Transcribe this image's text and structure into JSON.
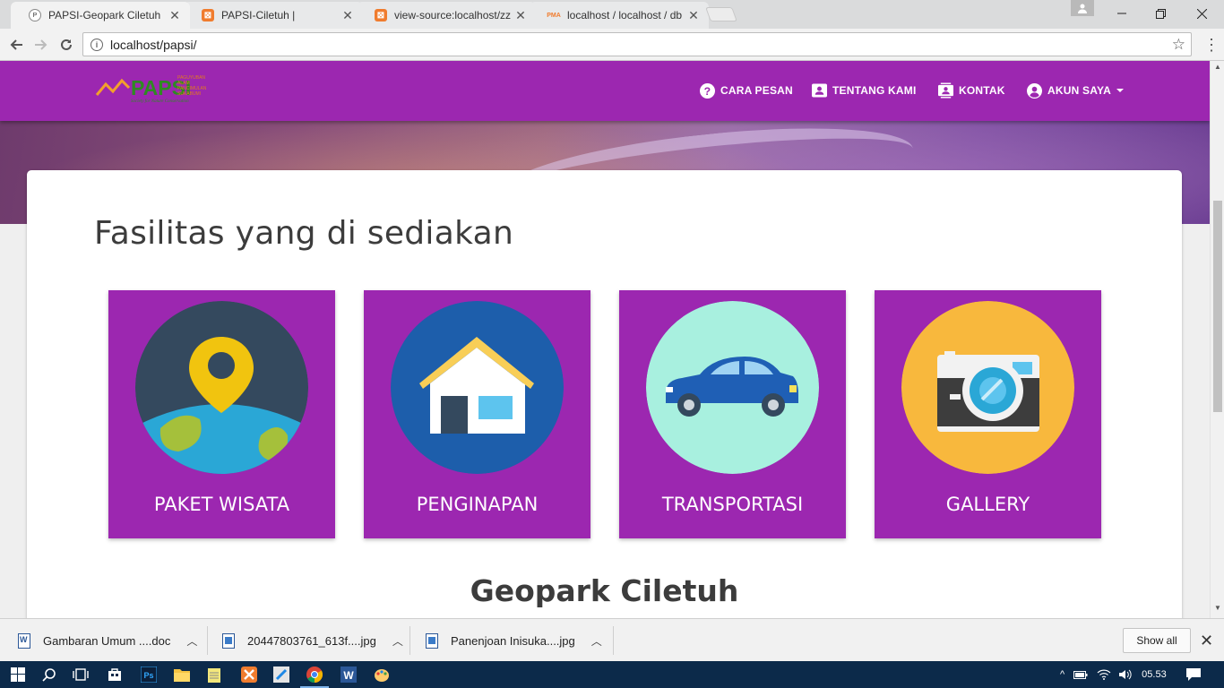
{
  "browser": {
    "tabs": [
      {
        "title": "PAPSI-Geopark Ciletuh",
        "active": true,
        "favicon": "papsi-logo-icon"
      },
      {
        "title": "PAPSI-Ciletuh |",
        "active": false,
        "favicon": "xampp-icon"
      },
      {
        "title": "view-source:localhost/zz",
        "active": false,
        "favicon": "xampp-icon"
      },
      {
        "title": "localhost / localhost / db",
        "active": false,
        "favicon": "phpmyadmin-icon"
      }
    ],
    "url": "localhost/papsi/"
  },
  "site": {
    "brand_color": "#9c27b0",
    "logo": {
      "text": "PAPSI",
      "subtext": "PAGUYUBAN ALAM PANCIMULAN SUKABUMI",
      "tagline": "Society for Nature Conservation"
    },
    "nav": [
      {
        "label": "CARA PESAN",
        "icon": "help-circle-icon"
      },
      {
        "label": "TENTANG KAMI",
        "icon": "id-card-icon"
      },
      {
        "label": "KONTAK",
        "icon": "contact-card-icon"
      },
      {
        "label": "AKUN SAYA",
        "icon": "account-circle-icon",
        "dropdown": true
      }
    ],
    "section_title": "Fasilitas yang di sediakan",
    "features": [
      {
        "label": "PAKET WISATA",
        "icon": "map-pin-globe-icon",
        "circle_color": "#34495e"
      },
      {
        "label": "PENGINAPAN",
        "icon": "house-icon",
        "circle_color": "#1d5eab"
      },
      {
        "label": "TRANSPORTASI",
        "icon": "car-icon",
        "circle_color": "#a8f0df"
      },
      {
        "label": "GALLERY",
        "icon": "camera-icon",
        "circle_color": "#f8b83d"
      }
    ],
    "geopark_title": "Geopark Ciletuh"
  },
  "downloads": {
    "items": [
      {
        "name": "Gambaran Umum ....doc",
        "type": "doc"
      },
      {
        "name": "20447803761_613f....jpg",
        "type": "jpg"
      },
      {
        "name": "Panenjoan Inisuka....jpg",
        "type": "jpg"
      }
    ],
    "show_all": "Show all"
  },
  "taskbar": {
    "clock": "05.53"
  }
}
